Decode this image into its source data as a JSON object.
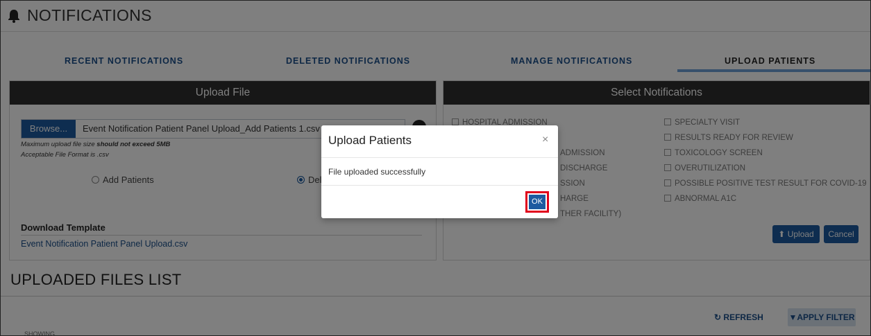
{
  "header": {
    "title": "NOTIFICATIONS",
    "icon": "bell-icon"
  },
  "tabs": [
    {
      "label": "RECENT NOTIFICATIONS",
      "active": false
    },
    {
      "label": "DELETED NOTIFICATIONS",
      "active": false
    },
    {
      "label": "MANAGE NOTIFICATIONS",
      "active": false
    },
    {
      "label": "UPLOAD PATIENTS",
      "active": true
    }
  ],
  "upload_panel": {
    "title": "Upload File",
    "browse_label": "Browse...",
    "file_name": "Event Notification Patient Panel Upload_Add Patients 1.csv",
    "max_size_prefix": "Maximum upload file size ",
    "max_size_bold": "should not exceed 5MB",
    "format_hint": "Acceptable File Format is .csv",
    "options": [
      {
        "label": "Add Patients",
        "selected": false
      },
      {
        "label": "Dele",
        "selected": true
      }
    ],
    "download_title": "Download Template",
    "download_link": "Event Notification Patient Panel Upload.csv"
  },
  "notifications_panel": {
    "title": "Select Notifications",
    "left_items": [
      "HOSPITAL ADMISSION",
      "ADMISSION",
      "DISCHARGE",
      "SSION",
      "HARGE",
      "THER FACILITY)"
    ],
    "right_items": [
      "SPECIALTY VISIT",
      "RESULTS READY FOR REVIEW",
      "TOXICOLOGY SCREEN",
      "OVERUTILIZATION",
      "POSSIBLE POSITIVE TEST RESULT FOR COVID-19",
      "ABNORMAL A1C"
    ],
    "upload_label": "Upload",
    "cancel_label": "Cancel"
  },
  "uploaded_files": {
    "title": "UPLOADED FILES LIST",
    "refresh_label": "REFRESH",
    "apply_filter_label": "APPLY FILTER",
    "showing_label": "SHOWING"
  },
  "modal": {
    "title": "Upload Patients",
    "close": "×",
    "message": "File uploaded successfully",
    "ok_label": "OK"
  },
  "colors": {
    "accent": "#1c5aa0",
    "highlight": "#e0001b",
    "panel_header": "#2e2e2e"
  }
}
